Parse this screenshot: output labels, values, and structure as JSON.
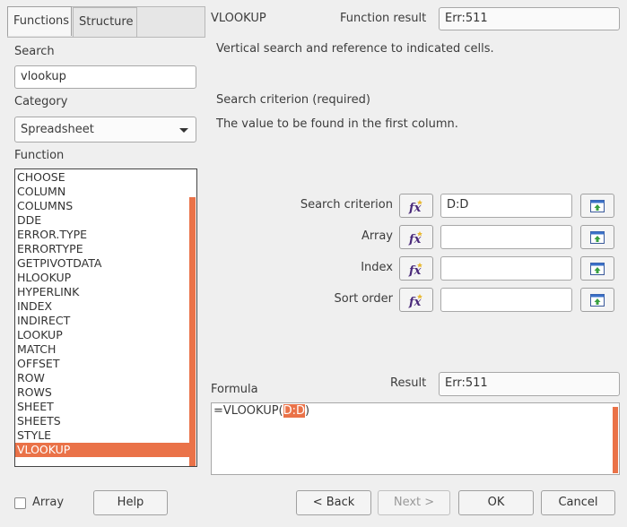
{
  "tabs": [
    {
      "label": "Functions",
      "active": true
    },
    {
      "label": "Structure",
      "active": false
    }
  ],
  "search": {
    "label": "Search",
    "value": "vlookup"
  },
  "category": {
    "label": "Category",
    "value": "Spreadsheet"
  },
  "function_list": {
    "label": "Function",
    "items": [
      "CHOOSE",
      "COLUMN",
      "COLUMNS",
      "DDE",
      "ERROR.TYPE",
      "ERRORTYPE",
      "GETPIVOTDATA",
      "HLOOKUP",
      "HYPERLINK",
      "INDEX",
      "INDIRECT",
      "LOOKUP",
      "MATCH",
      "OFFSET",
      "ROW",
      "ROWS",
      "SHEET",
      "SHEETS",
      "STYLE",
      "VLOOKUP"
    ],
    "selected": "VLOOKUP"
  },
  "header": {
    "function_name": "VLOOKUP",
    "function_result_label": "Function result",
    "function_result_value": "Err:511"
  },
  "description": "Vertical search and reference to indicated cells.",
  "argument_help": {
    "title": "Search criterion (required)",
    "text": "The value to be found in the first column."
  },
  "arguments": [
    {
      "label": "Search criterion",
      "value": "D:D",
      "fx_icon": "function-wizard-icon",
      "shrink_icon": "shrink-icon"
    },
    {
      "label": "Array",
      "value": "",
      "fx_icon": "function-wizard-icon",
      "shrink_icon": "shrink-icon"
    },
    {
      "label": "Index",
      "value": "",
      "fx_icon": "function-wizard-icon",
      "shrink_icon": "shrink-icon"
    },
    {
      "label": "Sort order",
      "value": "",
      "fx_icon": "function-wizard-icon",
      "shrink_icon": "shrink-icon"
    }
  ],
  "result": {
    "label": "Result",
    "value": "Err:511"
  },
  "formula": {
    "label": "Formula",
    "prefix": "=VLOOKUP(",
    "highlight": "D:D",
    "suffix": ")"
  },
  "footer": {
    "array_label": "Array",
    "array_checked": false,
    "help": "Help",
    "back": "< Back",
    "next": "Next >",
    "ok": "OK",
    "cancel": "Cancel"
  },
  "colors": {
    "accent": "#ea7248"
  }
}
